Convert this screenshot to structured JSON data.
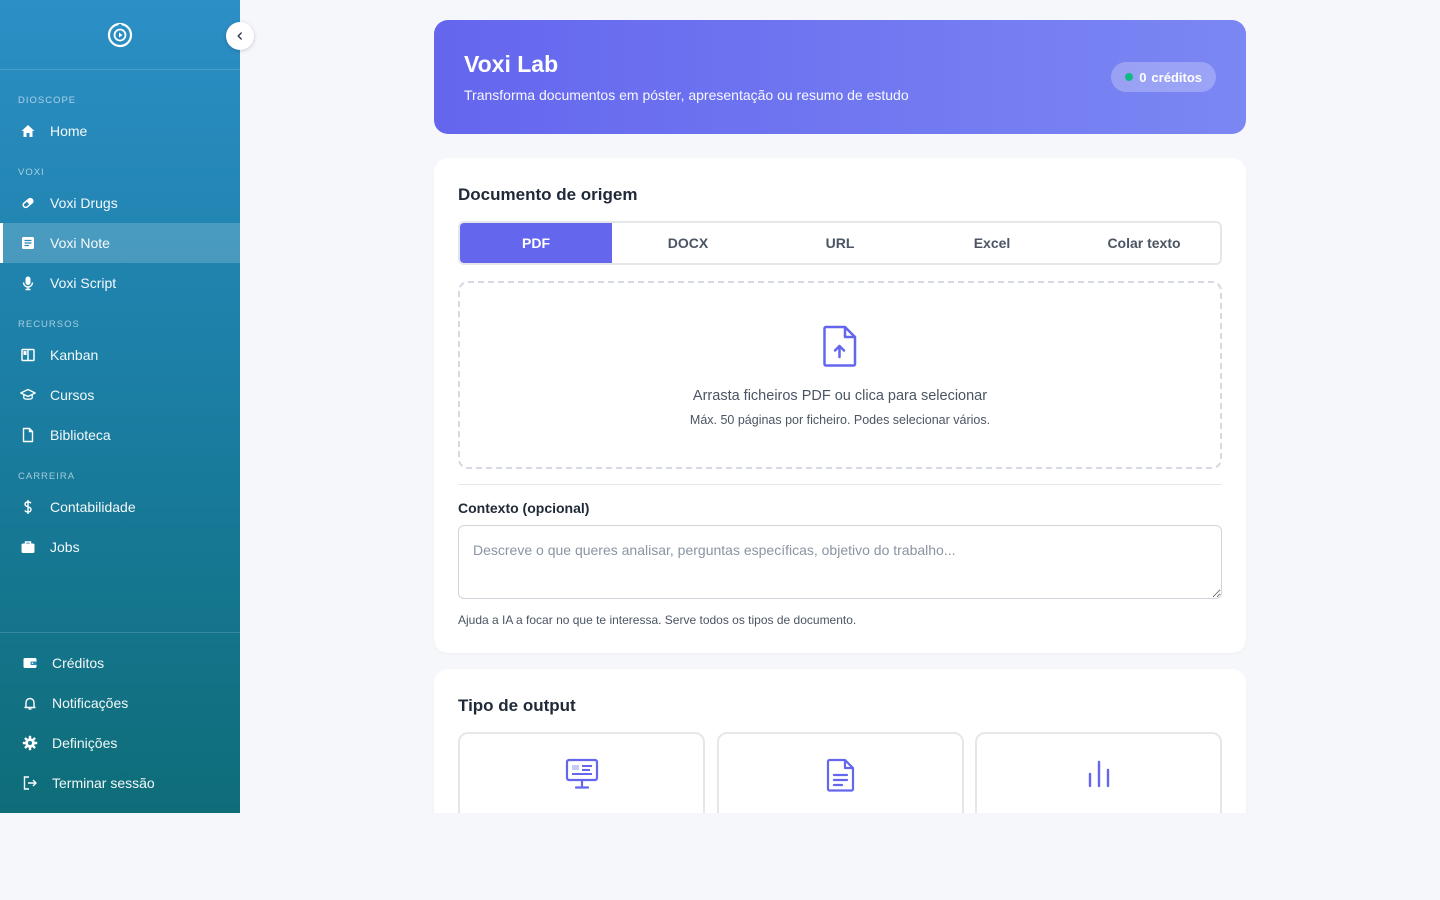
{
  "sidebar": {
    "sections": [
      {
        "label": "DIOSCOPE",
        "items": [
          {
            "label": "Home",
            "icon": "home-icon"
          }
        ]
      },
      {
        "label": "VOXI",
        "items": [
          {
            "label": "Voxi Drugs",
            "icon": "pill-icon"
          },
          {
            "label": "Voxi Note",
            "icon": "note-icon",
            "active": true
          },
          {
            "label": "Voxi Script",
            "icon": "microphone-icon"
          }
        ]
      },
      {
        "label": "RECURSOS",
        "items": [
          {
            "label": "Kanban",
            "icon": "kanban-icon"
          },
          {
            "label": "Cursos",
            "icon": "graduation-cap-icon"
          },
          {
            "label": "Biblioteca",
            "icon": "document-icon"
          }
        ]
      },
      {
        "label": "CARREIRA",
        "items": [
          {
            "label": "Contabilidade",
            "icon": "dollar-icon"
          },
          {
            "label": "Jobs",
            "icon": "briefcase-icon"
          }
        ]
      }
    ],
    "bottom": [
      {
        "label": "Créditos",
        "icon": "wallet-icon"
      },
      {
        "label": "Notificações",
        "icon": "bell-icon"
      },
      {
        "label": "Definições",
        "icon": "gear-icon"
      },
      {
        "label": "Terminar sessão",
        "icon": "logout-icon"
      }
    ]
  },
  "hero": {
    "title": "Voxi Lab",
    "subtitle": "Transforma documentos em póster, apresentação ou resumo de estudo",
    "credits_count": "0",
    "credits_label": "créditos"
  },
  "source": {
    "title": "Documento de origem",
    "tabs": [
      "PDF",
      "DOCX",
      "URL",
      "Excel",
      "Colar texto"
    ],
    "active_tab": "PDF",
    "dropzone_main": "Arrasta ficheiros PDF ou clica para selecionar",
    "dropzone_sub": "Máx. 50 páginas por ficheiro. Podes selecionar vários.",
    "context_label": "Contexto (opcional)",
    "context_placeholder": "Descreve o que queres analisar, perguntas específicas, objetivo do trabalho...",
    "context_value": "",
    "context_help": "Ajuda a IA a focar no que te interessa. Serve todos os tipos de documento."
  },
  "output": {
    "title": "Tipo de output",
    "options": [
      {
        "icon": "presentation-icon"
      },
      {
        "icon": "document-icon"
      },
      {
        "icon": "bar-chart-icon"
      }
    ]
  },
  "colors": {
    "accent": "#6466ee",
    "sidebar_top": "#2c8fc6",
    "sidebar_bottom": "#0e6d78",
    "credits_dot": "#10b981"
  }
}
